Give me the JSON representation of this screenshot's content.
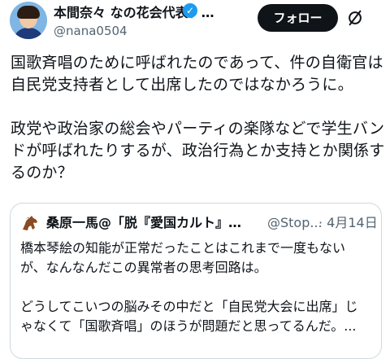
{
  "author": {
    "display_name": "本間奈々 なの花会代表、…",
    "handle": "@nana0504",
    "verified_icon": "verified-badge-icon"
  },
  "actions": {
    "follow_label": "フォロー",
    "more_icon": "grok-slash-icon"
  },
  "post": {
    "text": "国歌斉唱のために呼ばれたのであって、件の自衛官は\n自民党支持者として出席したのではなかろうに。\n\n政党や政治家の総会やパーティの楽隊などで学生バン\nドが呼ばれたりするが、政治行為とか支持とか関係す\nるのか？"
  },
  "quote": {
    "display_name": "桑原一馬@「脱『愛国カルト』…",
    "handle": "@Stop...",
    "date": "· 4月14日",
    "text": "橋本琴絵の知能が正常だったことはこれまで一度もない\nが、なんなんだこの異常者の思考回路は。\n\nどうしてこいつの脳みその中だと「自民党大会に出席」じ\nゃなくて「国歌斉唱」のほうが問題だと思ってるんだ。..."
  },
  "colors": {
    "text": "#0f1419",
    "secondary": "#536471",
    "verified": "#1d9bf0",
    "border": "#cfd9de"
  }
}
